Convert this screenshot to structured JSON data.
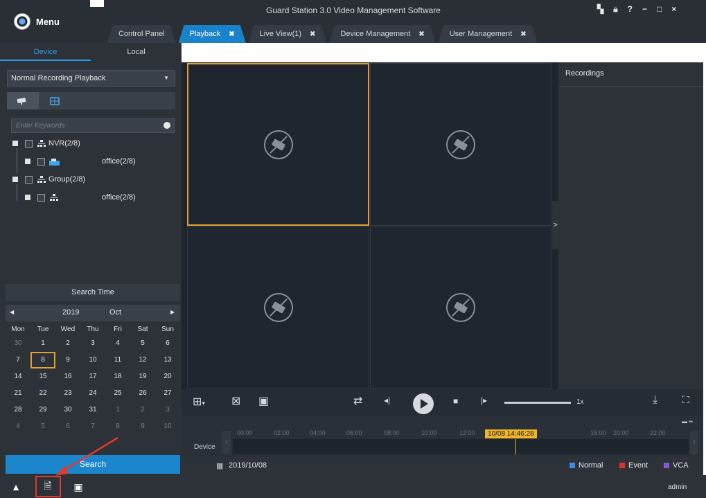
{
  "app": {
    "title": "Guard Station 3.0 Video Management Software",
    "menu_label": "Menu"
  },
  "tabs": [
    {
      "label": "Control Panel",
      "closable": false
    },
    {
      "label": "Playback",
      "closable": true,
      "active": true
    },
    {
      "label": "Live View(1)",
      "closable": true
    },
    {
      "label": "Device Management",
      "closable": true
    },
    {
      "label": "User Management",
      "closable": true
    }
  ],
  "window_controls": {
    "minimize": "−",
    "maximize": "□",
    "close": "×"
  },
  "left": {
    "tabs": [
      "Device",
      "Local"
    ],
    "mode": "Normal Recording Playback",
    "search_placeholder": "Enter Keywords",
    "tree": [
      {
        "label": "NVR(2/8)",
        "level": 0,
        "icon": "network-icon"
      },
      {
        "label": "office(2/8)",
        "level": 1,
        "icon": "device-icon"
      },
      {
        "label": "Group(2/8)",
        "level": 0,
        "icon": "network-icon"
      },
      {
        "label": "office(2/8)",
        "level": 1,
        "icon": "network-icon"
      }
    ],
    "search_time": "Search Time",
    "calendar": {
      "year": "2019",
      "month": "Oct",
      "weekdays": [
        "Mon",
        "Tue",
        "Wed",
        "Thu",
        "Fri",
        "Sat",
        "Sun"
      ],
      "days": [
        [
          "30",
          "1",
          "2",
          "3",
          "4",
          "5",
          "6"
        ],
        [
          "7",
          "8",
          "9",
          "10",
          "11",
          "12",
          "13"
        ],
        [
          "14",
          "15",
          "16",
          "17",
          "18",
          "19",
          "20"
        ],
        [
          "21",
          "22",
          "23",
          "24",
          "25",
          "26",
          "27"
        ],
        [
          "28",
          "29",
          "30",
          "31",
          "1",
          "2",
          "3"
        ],
        [
          "4",
          "5",
          "6",
          "7",
          "8",
          "9",
          "10"
        ]
      ],
      "selected": "8"
    },
    "search_button": "Search"
  },
  "recordings": {
    "title": "Recordings",
    "toggle": ">"
  },
  "controls": {
    "speed": "1x"
  },
  "timeline": {
    "device_label": "Device",
    "ticks": [
      "00:00",
      "02:00",
      "04:00",
      "06:00",
      "08:00",
      "10:00",
      "12:00",
      "16:00",
      "20:00",
      "22:00"
    ],
    "cursor_time": "10/08 14:46:28",
    "date": "2019/10/08",
    "legend": [
      {
        "label": "Normal",
        "color": "#3a8ee6"
      },
      {
        "label": "Event",
        "color": "#e0322b"
      },
      {
        "label": "VCA",
        "color": "#8a56d8"
      }
    ]
  },
  "status": {
    "user": "admin"
  },
  "colors": {
    "accent": "#1a82c9",
    "highlight": "#e5a034",
    "annotation": "#e03a2f"
  }
}
